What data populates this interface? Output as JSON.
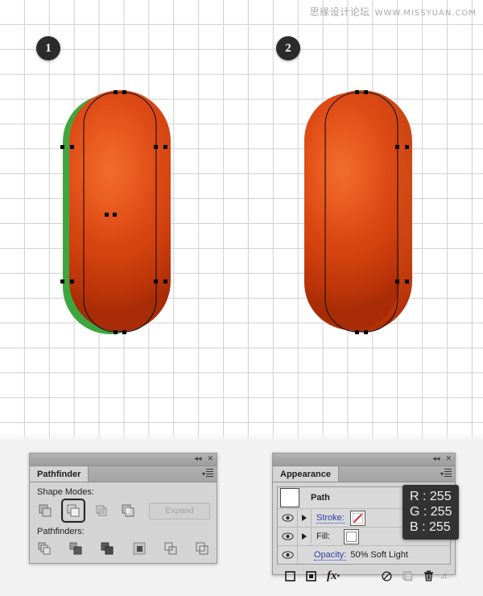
{
  "watermark": {
    "cn_text": "思缘设计论坛",
    "url_text": "WWW.MISSYUAN.COM"
  },
  "canvas": {
    "steps": [
      {
        "label": "1",
        "name": "step-badge-1"
      },
      {
        "label": "2",
        "name": "step-badge-2"
      }
    ],
    "shapes": {
      "green_color": "#3ea63f",
      "orange_light": "#e8591e",
      "orange_dark": "#a82c06"
    }
  },
  "pathfinder_panel": {
    "title": "Pathfinder",
    "collapse_icon": "collapse-to-icons-icon",
    "close_icon": "close-icon",
    "menu_icon": "panel-menu-icon",
    "shape_modes_label": "Shape Modes:",
    "shape_modes": [
      {
        "name": "unite-icon",
        "selected": false
      },
      {
        "name": "minus-front-icon",
        "selected": true
      },
      {
        "name": "intersect-icon",
        "selected": false
      },
      {
        "name": "exclude-icon",
        "selected": false
      }
    ],
    "expand_label": "Expand",
    "pathfinders_label": "Pathfinders:",
    "pathfinders": [
      {
        "name": "divide-icon"
      },
      {
        "name": "trim-icon"
      },
      {
        "name": "merge-icon"
      },
      {
        "name": "crop-icon"
      },
      {
        "name": "outline-icon"
      },
      {
        "name": "minus-back-icon"
      }
    ]
  },
  "appearance_panel": {
    "title": "Appearance",
    "collapse_icon": "collapse-to-icons-icon",
    "close_icon": "close-icon",
    "menu_icon": "panel-menu-icon",
    "path_row_label": "Path",
    "stroke_label": "Stroke:",
    "fill_label": "Fill:",
    "opacity_label": "Opacity:",
    "opacity_value": "50% Soft Light",
    "stroke_swatch": "none-stroke-swatch",
    "fill_swatch_color": "#ffffff",
    "footer": [
      {
        "name": "add-new-stroke-icon"
      },
      {
        "name": "add-new-fill-icon"
      },
      {
        "name": "add-new-effect-icon"
      },
      {
        "name": "clear-appearance-icon"
      },
      {
        "name": "duplicate-item-icon"
      },
      {
        "name": "delete-item-icon"
      }
    ]
  },
  "color_tooltip": {
    "r": "R : 255",
    "g": "G : 255",
    "b": "B : 255",
    "background": "#333333"
  }
}
